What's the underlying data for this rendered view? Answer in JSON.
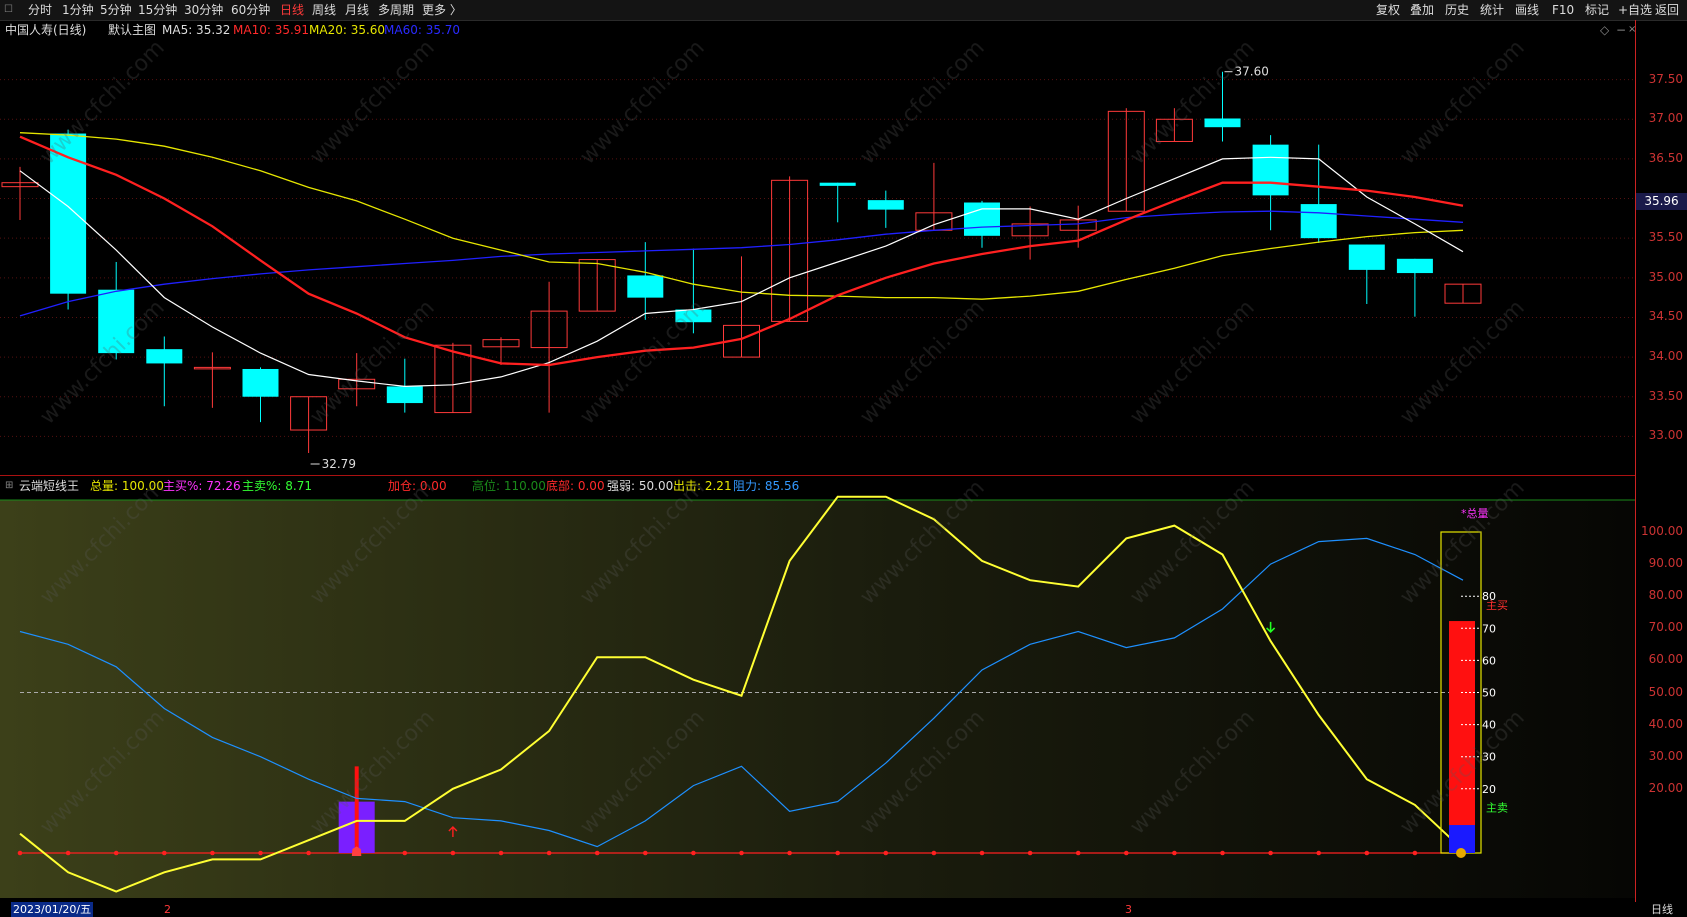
{
  "toolbar": {
    "left_icon": "menu-icon",
    "periods": [
      "分时",
      "1分钟",
      "5分钟",
      "15分钟",
      "30分钟",
      "60分钟",
      "日线",
      "周线",
      "月线",
      "多周期",
      "更多 〉"
    ],
    "active_period": "日线",
    "right_buttons": [
      "复权",
      "叠加",
      "历史",
      "统计",
      "画线",
      "F10",
      "标记",
      "+自选",
      "返回"
    ]
  },
  "infobar": {
    "stock": "中国人寿(日线)",
    "main_chart": "默认主图",
    "ma5_label": "MA5: 35.32",
    "ma10_label": "MA10: 35.91",
    "ma20_label": "MA20: 35.60",
    "ma60_label": "MA60: 35.70",
    "icons": [
      "diamond-icon",
      "minimize-icon",
      "close-icon"
    ]
  },
  "colors": {
    "up": "#ff3a3a",
    "down": "#00ffff",
    "ma5": "#ffffff",
    "ma10": "#ff2020",
    "ma20": "#e6e600",
    "ma60": "#2020ff",
    "osc_yellow": "#ffff33",
    "osc_blue": "#1e90ff"
  },
  "price_chart": {
    "ylim": [
      32.5,
      38.0
    ],
    "ticks": [
      "37.50",
      "37.00",
      "36.50",
      "36.00",
      "35.50",
      "35.00",
      "34.50",
      "34.00",
      "33.50",
      "33.00"
    ],
    "current_price": "35.96",
    "high_label": "37.60",
    "low_label": "32.79",
    "candles": [
      {
        "o": 36.15,
        "c": 36.2,
        "h": 36.4,
        "l": 35.73
      },
      {
        "o": 36.82,
        "c": 34.8,
        "h": 36.87,
        "l": 34.6
      },
      {
        "o": 34.85,
        "c": 34.05,
        "h": 35.2,
        "l": 33.97
      },
      {
        "o": 34.1,
        "c": 33.92,
        "h": 34.26,
        "l": 33.38
      },
      {
        "o": 33.87,
        "c": 33.87,
        "h": 34.06,
        "l": 33.36
      },
      {
        "o": 33.85,
        "c": 33.5,
        "h": 33.87,
        "l": 33.18
      },
      {
        "o": 33.08,
        "c": 33.5,
        "h": 33.5,
        "l": 32.79
      },
      {
        "o": 33.6,
        "c": 33.72,
        "h": 34.05,
        "l": 33.38
      },
      {
        "o": 33.63,
        "c": 33.42,
        "h": 33.98,
        "l": 33.3
      },
      {
        "o": 33.3,
        "c": 34.15,
        "h": 34.18,
        "l": 33.3
      },
      {
        "o": 34.13,
        "c": 34.22,
        "h": 34.25,
        "l": 33.9
      },
      {
        "o": 34.12,
        "c": 34.58,
        "h": 34.95,
        "l": 33.3
      },
      {
        "o": 34.58,
        "c": 35.23,
        "h": 35.23,
        "l": 34.58
      },
      {
        "o": 35.03,
        "c": 34.75,
        "h": 35.45,
        "l": 34.47
      },
      {
        "o": 34.6,
        "c": 34.44,
        "h": 35.37,
        "l": 34.3
      },
      {
        "o": 34.0,
        "c": 34.4,
        "h": 35.27,
        "l": 34.0
      },
      {
        "o": 34.45,
        "c": 36.23,
        "h": 36.28,
        "l": 34.45
      },
      {
        "o": 36.2,
        "c": 36.16,
        "h": 36.2,
        "l": 35.7
      },
      {
        "o": 35.98,
        "c": 35.86,
        "h": 36.1,
        "l": 35.63
      },
      {
        "o": 35.6,
        "c": 35.82,
        "h": 36.45,
        "l": 35.6
      },
      {
        "o": 35.95,
        "c": 35.53,
        "h": 35.97,
        "l": 35.38
      },
      {
        "o": 35.53,
        "c": 35.68,
        "h": 35.9,
        "l": 35.23
      },
      {
        "o": 35.6,
        "c": 35.73,
        "h": 35.91,
        "l": 35.38
      },
      {
        "o": 35.84,
        "c": 37.1,
        "h": 37.14,
        "l": 35.84
      },
      {
        "o": 36.72,
        "c": 37.0,
        "h": 37.14,
        "l": 36.72
      },
      {
        "o": 37.01,
        "c": 36.9,
        "h": 37.6,
        "l": 36.72
      },
      {
        "o": 36.68,
        "c": 36.04,
        "h": 36.8,
        "l": 35.6
      },
      {
        "o": 35.93,
        "c": 35.5,
        "h": 36.68,
        "l": 35.44
      },
      {
        "o": 35.42,
        "c": 35.1,
        "h": 35.42,
        "l": 34.67
      },
      {
        "o": 35.24,
        "c": 35.06,
        "h": 35.24,
        "l": 34.51
      },
      {
        "o": 34.68,
        "c": 34.92,
        "h": 34.92,
        "l": 34.68
      }
    ],
    "ma5": [
      [
        0,
        36.35
      ],
      [
        1,
        35.9
      ],
      [
        2,
        35.35
      ],
      [
        3,
        34.75
      ],
      [
        4,
        34.38
      ],
      [
        5,
        34.05
      ],
      [
        6,
        33.78
      ],
      [
        7,
        33.7
      ],
      [
        8,
        33.63
      ],
      [
        9,
        33.65
      ],
      [
        10,
        33.75
      ],
      [
        11,
        33.93
      ],
      [
        12,
        34.2
      ],
      [
        13,
        34.55
      ],
      [
        14,
        34.6
      ],
      [
        15,
        34.7
      ],
      [
        16,
        35.0
      ],
      [
        17,
        35.2
      ],
      [
        18,
        35.4
      ],
      [
        19,
        35.67
      ],
      [
        20,
        35.87
      ],
      [
        21,
        35.87
      ],
      [
        22,
        35.74
      ],
      [
        23,
        36.0
      ],
      [
        24,
        36.25
      ],
      [
        25,
        36.5
      ],
      [
        26,
        36.52
      ],
      [
        27,
        36.5
      ],
      [
        28,
        36.02
      ],
      [
        29,
        35.68
      ],
      [
        30,
        35.33
      ]
    ],
    "ma10": [
      [
        0,
        36.78
      ],
      [
        1,
        36.52
      ],
      [
        2,
        36.3
      ],
      [
        3,
        36.0
      ],
      [
        4,
        35.65
      ],
      [
        5,
        35.22
      ],
      [
        6,
        34.8
      ],
      [
        7,
        34.55
      ],
      [
        8,
        34.25
      ],
      [
        9,
        34.07
      ],
      [
        10,
        33.92
      ],
      [
        11,
        33.9
      ],
      [
        12,
        34.0
      ],
      [
        13,
        34.08
      ],
      [
        14,
        34.12
      ],
      [
        15,
        34.23
      ],
      [
        16,
        34.48
      ],
      [
        17,
        34.78
      ],
      [
        18,
        35.0
      ],
      [
        19,
        35.18
      ],
      [
        20,
        35.3
      ],
      [
        21,
        35.4
      ],
      [
        22,
        35.47
      ],
      [
        23,
        35.73
      ],
      [
        24,
        35.97
      ],
      [
        25,
        36.2
      ],
      [
        26,
        36.2
      ],
      [
        27,
        36.15
      ],
      [
        28,
        36.1
      ],
      [
        29,
        36.02
      ],
      [
        30,
        35.91
      ]
    ],
    "ma20": [
      [
        0,
        36.83
      ],
      [
        1,
        36.8
      ],
      [
        2,
        36.75
      ],
      [
        3,
        36.66
      ],
      [
        4,
        36.52
      ],
      [
        5,
        36.35
      ],
      [
        6,
        36.14
      ],
      [
        7,
        35.97
      ],
      [
        8,
        35.74
      ],
      [
        9,
        35.5
      ],
      [
        10,
        35.35
      ],
      [
        11,
        35.2
      ],
      [
        12,
        35.18
      ],
      [
        13,
        35.07
      ],
      [
        14,
        34.92
      ],
      [
        15,
        34.82
      ],
      [
        16,
        34.78
      ],
      [
        17,
        34.77
      ],
      [
        18,
        34.75
      ],
      [
        19,
        34.75
      ],
      [
        20,
        34.73
      ],
      [
        21,
        34.77
      ],
      [
        22,
        34.83
      ],
      [
        23,
        34.98
      ],
      [
        24,
        35.12
      ],
      [
        25,
        35.28
      ],
      [
        26,
        35.37
      ],
      [
        27,
        35.45
      ],
      [
        28,
        35.52
      ],
      [
        29,
        35.57
      ],
      [
        30,
        35.6
      ]
    ],
    "ma60": [
      [
        0,
        34.52
      ],
      [
        1,
        34.7
      ],
      [
        2,
        34.83
      ],
      [
        3,
        34.92
      ],
      [
        4,
        34.99
      ],
      [
        5,
        35.05
      ],
      [
        6,
        35.1
      ],
      [
        7,
        35.14
      ],
      [
        8,
        35.18
      ],
      [
        9,
        35.22
      ],
      [
        10,
        35.27
      ],
      [
        11,
        35.3
      ],
      [
        12,
        35.32
      ],
      [
        13,
        35.34
      ],
      [
        14,
        35.36
      ],
      [
        15,
        35.38
      ],
      [
        16,
        35.42
      ],
      [
        17,
        35.48
      ],
      [
        18,
        35.55
      ],
      [
        19,
        35.6
      ],
      [
        20,
        35.64
      ],
      [
        21,
        35.66
      ],
      [
        22,
        35.68
      ],
      [
        23,
        35.76
      ],
      [
        24,
        35.8
      ],
      [
        25,
        35.83
      ],
      [
        26,
        35.84
      ],
      [
        27,
        35.82
      ],
      [
        28,
        35.78
      ],
      [
        29,
        35.74
      ],
      [
        30,
        35.7
      ]
    ]
  },
  "osc_info": {
    "name": "云端短线王",
    "zongliang": "总量: 100.00",
    "zhumai": "主买%: 72.26",
    "zhumai2": "主卖%: 8.71",
    "jiacang": "加仓: 0.00",
    "gaowei": "高位: 110.00",
    "dibu": "底部: 0.00",
    "qiangruo": "强弱: 50.00",
    "chuji": "出击: 2.21",
    "zuli": "阻力: 85.56"
  },
  "osc_chart": {
    "ylim": [
      -5,
      111
    ],
    "ticks": [
      "100.00",
      "90.00",
      "80.00",
      "70.00",
      "60.00",
      "50.00",
      "40.00",
      "30.00",
      "20.00"
    ],
    "yellow": [
      [
        0,
        6
      ],
      [
        1,
        -6
      ],
      [
        2,
        -12
      ],
      [
        3,
        -6
      ],
      [
        4,
        -2
      ],
      [
        5,
        -2
      ],
      [
        6,
        4
      ],
      [
        7,
        10
      ],
      [
        8,
        10
      ],
      [
        9,
        20
      ],
      [
        10,
        26
      ],
      [
        11,
        38
      ],
      [
        12,
        61
      ],
      [
        13,
        61
      ],
      [
        14,
        54
      ],
      [
        15,
        49
      ],
      [
        16,
        91
      ],
      [
        17,
        111
      ],
      [
        18,
        111
      ],
      [
        19,
        104
      ],
      [
        20,
        91
      ],
      [
        21,
        85
      ],
      [
        22,
        83
      ],
      [
        23,
        98
      ],
      [
        24,
        102
      ],
      [
        25,
        93
      ],
      [
        26,
        66
      ],
      [
        27,
        43
      ],
      [
        28,
        23
      ],
      [
        29,
        15
      ],
      [
        30,
        1
      ]
    ],
    "blue": [
      [
        0,
        69
      ],
      [
        1,
        65
      ],
      [
        2,
        58
      ],
      [
        3,
        45
      ],
      [
        4,
        36
      ],
      [
        5,
        30
      ],
      [
        6,
        23
      ],
      [
        7,
        17
      ],
      [
        8,
        16
      ],
      [
        9,
        11
      ],
      [
        10,
        10
      ],
      [
        11,
        7
      ],
      [
        12,
        2
      ],
      [
        13,
        10
      ],
      [
        14,
        21
      ],
      [
        15,
        27
      ],
      [
        16,
        13
      ],
      [
        17,
        16
      ],
      [
        18,
        28
      ],
      [
        19,
        42
      ],
      [
        20,
        57
      ],
      [
        21,
        65
      ],
      [
        22,
        69
      ],
      [
        23,
        64
      ],
      [
        24,
        67
      ],
      [
        25,
        76
      ],
      [
        26,
        90
      ],
      [
        27,
        97
      ],
      [
        28,
        98
      ],
      [
        29,
        93
      ],
      [
        30,
        85
      ]
    ],
    "dashed_level": 50,
    "total_box_label": "*总量",
    "box_ticks": [
      "80",
      "70",
      "60",
      "50",
      "40",
      "30",
      "20"
    ],
    "zhumai_label": "主买",
    "zhumai2_label": "主卖",
    "box_red_value": 72.26,
    "box_blue_value": 8.71
  },
  "bottom": {
    "date": "2023/01/20/五",
    "month_2": "2",
    "month_3": "3",
    "period": "日线"
  },
  "watermark": "www.cfchi.com"
}
